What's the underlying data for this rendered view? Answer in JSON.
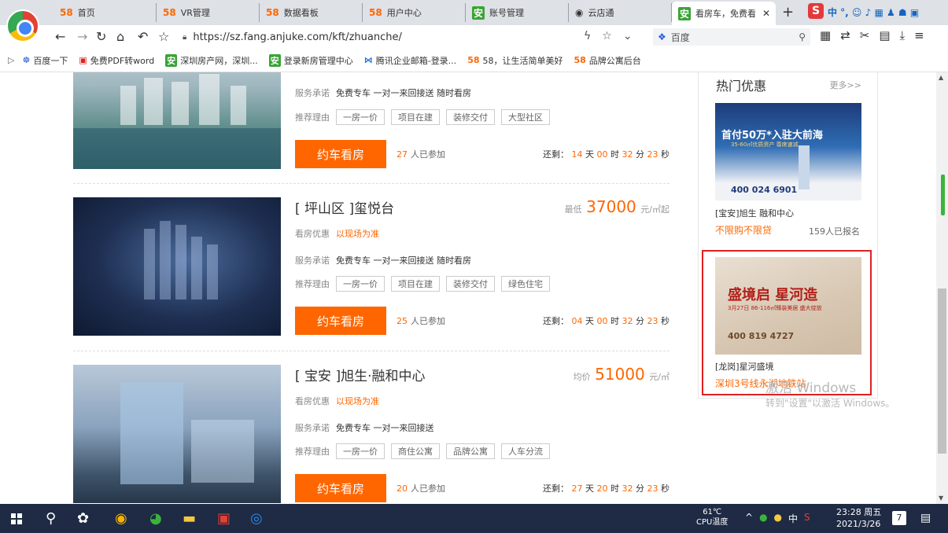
{
  "browser": {
    "tabs": [
      {
        "icon": "58",
        "label": "首页"
      },
      {
        "icon": "58",
        "label": "VR管理"
      },
      {
        "icon": "58",
        "label": "数据看板"
      },
      {
        "icon": "58",
        "label": "用户中心"
      },
      {
        "icon": "安",
        "label": "账号管理"
      },
      {
        "icon": "◉",
        "label": "云店通"
      },
      {
        "icon": "安",
        "label": "看房车，免费看"
      }
    ],
    "new_tab": "+",
    "url": "https://sz.fang.anjuke.com/kft/zhuanche/",
    "search_placeholder": "百度",
    "ext_text": "中 °, ☺ ♪ ▦ ♟ ☗ ▣",
    "bookmarks": [
      {
        "icon": "☸",
        "label": "百度一下"
      },
      {
        "icon": "▣",
        "label": "免费PDF转word"
      },
      {
        "icon": "安",
        "label": "深圳房产网，深圳..."
      },
      {
        "icon": "安",
        "label": "登录新房管理中心"
      },
      {
        "icon": "⋈",
        "label": "腾讯企业邮箱-登录..."
      },
      {
        "icon": "58",
        "label": "58，让生活简单美好"
      },
      {
        "icon": "58",
        "label": "品牌公寓后台"
      }
    ]
  },
  "listings": [
    {
      "service_label": "服务承诺",
      "service": "免费专车 一对一来回接送 随时看房",
      "reason_label": "推荐理由",
      "tags": [
        "一房一价",
        "项目在建",
        "装修交付",
        "大型社区"
      ],
      "button": "约车看房",
      "joined_count": "27",
      "joined_text": "人已参加",
      "remain_label": "还剩：",
      "days": "14",
      "hours": "00",
      "minutes": "32",
      "seconds": "23"
    },
    {
      "title": "[ 坪山区 ]玺悦台",
      "price_prefix": "最低",
      "price": "37000",
      "price_unit": "元/㎡起",
      "discount_label": "看房优惠",
      "discount": "以现场为准",
      "service_label": "服务承诺",
      "service": "免费专车 一对一来回接送 随时看房",
      "reason_label": "推荐理由",
      "tags": [
        "一房一价",
        "项目在建",
        "装修交付",
        "绿色住宅"
      ],
      "button": "约车看房",
      "joined_count": "25",
      "joined_text": "人已参加",
      "remain_label": "还剩：",
      "days": "04",
      "hours": "00",
      "minutes": "32",
      "seconds": "23"
    },
    {
      "title": "[ 宝安 ]旭生·融和中心",
      "price_prefix": "均价",
      "price": "51000",
      "price_unit": "元/㎡",
      "discount_label": "看房优惠",
      "discount": "以现场为准",
      "service_label": "服务承诺",
      "service": "免费专车 一对一来回接送",
      "reason_label": "推荐理由",
      "tags": [
        "一房一价",
        "商住公寓",
        "品牌公寓",
        "人车分流"
      ],
      "button": "约车看房",
      "joined_count": "20",
      "joined_text": "人已参加",
      "remain_label": "还剩：",
      "days": "27",
      "hours": "20",
      "minutes": "32",
      "seconds": "23"
    }
  ],
  "units": {
    "day": "天",
    "hour": "时",
    "minute": "分",
    "second": "秒"
  },
  "sidebar": {
    "title": "热门优惠",
    "more": "更多>>",
    "ad1": {
      "headline": "首付50万*入驻大前海",
      "sub": "35-60㎡优质资产 尊席速减",
      "phone": "400 024 6901",
      "name": "[宝安]旭生 融和中心",
      "promo": "不限购不限贷",
      "count": "159人已报名"
    },
    "ad2": {
      "headline": "盛境启 星河造",
      "sub": "3月27日 86-116㎡臻装美居 盛大绽放",
      "phone": "400 819 4727",
      "name": "[龙岗]星河盛境",
      "promo": "深圳3号线永湖地铁站"
    }
  },
  "watermark": {
    "line1": "激活 Windows",
    "line2": "转到\"设置\"以激活 Windows。"
  },
  "taskbar": {
    "temp": "61℃",
    "temp_label": "CPU温度",
    "ime": "中",
    "time": "23:28 周五",
    "date": "2021/3/26",
    "badge": "7"
  }
}
